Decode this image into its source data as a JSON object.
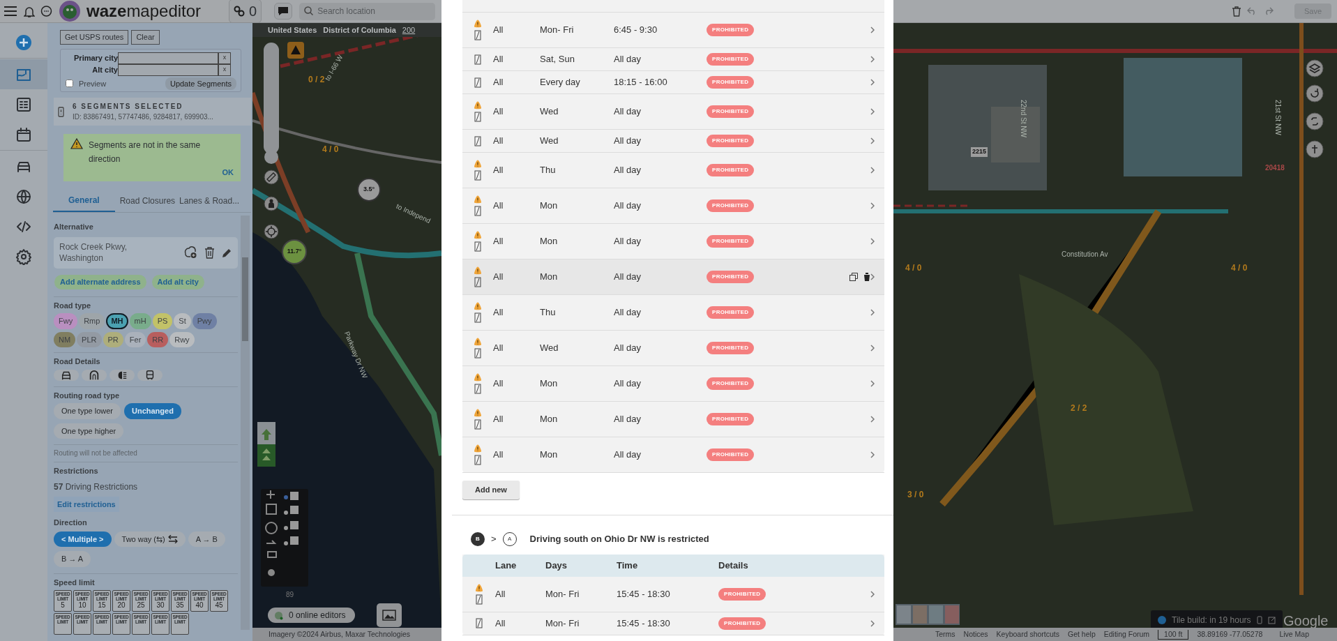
{
  "topbar": {
    "logo_bold": "waze",
    "logo_light": "mapeditor",
    "editors": "0",
    "search": {
      "placeholder": "Search location"
    },
    "save": {
      "label": "Save",
      "disabled": true
    }
  },
  "nav": [
    {
      "kind": "add",
      "selected": false
    },
    {
      "kind": "map",
      "selected": true
    },
    {
      "kind": "list",
      "selected": false
    },
    {
      "kind": "calendar",
      "selected": false
    },
    {
      "kind": "car",
      "selected": false
    },
    {
      "kind": "globe",
      "selected": false
    },
    {
      "kind": "code",
      "selected": false
    },
    {
      "kind": "gear",
      "selected": false
    }
  ],
  "panel": {
    "usps_buttons": [
      "Get USPS routes",
      "Clear"
    ],
    "city_fields": [
      {
        "label": "Primary city",
        "clear": "x"
      },
      {
        "label": "Alt city",
        "clear": "x"
      }
    ],
    "preview": {
      "label": "Preview",
      "checked": false
    },
    "update_button": "Update Segments",
    "selection": {
      "title": "6 SEGMENTS SELECTED",
      "ids": "ID: 83867491, 57747486, 9284817, 699903..."
    },
    "alert": {
      "text": "Segments are not in the same direction",
      "action": "OK"
    },
    "tabs": [
      {
        "label": "General",
        "selected": true
      },
      {
        "label": "Road Closures",
        "selected": false
      },
      {
        "label": "Lanes & Road...",
        "selected": false
      }
    ],
    "alternative": {
      "heading": "Alternative",
      "address": "Rock Creek Pkwy, Washington",
      "actions": [
        "Add alternate address",
        "Add alt city"
      ]
    },
    "road_type": {
      "heading": "Road type",
      "types": [
        {
          "label": "Fwy",
          "color": "#b98fc0",
          "selected": false
        },
        {
          "label": "Rmp",
          "color": "#9ea5a9",
          "selected": false
        },
        {
          "label": "MH",
          "color": "#4ba1b1",
          "selected": true
        },
        {
          "label": "mH",
          "color": "#79ac8b",
          "selected": false
        },
        {
          "label": "PS",
          "color": "#c2c268",
          "selected": false
        },
        {
          "label": "St",
          "color": "#b9bcbf",
          "selected": false
        },
        {
          "label": "Pwy",
          "color": "#6f80a4",
          "selected": false
        },
        {
          "label": "NM",
          "color": "#807e60",
          "selected": false
        },
        {
          "label": "PLR",
          "color": "#939aa3",
          "selected": false
        },
        {
          "label": "PR",
          "color": "#aeae7b",
          "selected": false
        },
        {
          "label": "Fer",
          "color": "#aab1bb",
          "selected": false
        },
        {
          "label": "RR",
          "color": "#b85e5e",
          "selected": false
        },
        {
          "label": "Rwy",
          "color": "#b9bcbf",
          "selected": false
        }
      ]
    },
    "road_details": {
      "heading": "Road Details",
      "items": [
        {
          "kind": "car"
        },
        {
          "kind": "tunnel"
        },
        {
          "kind": "headlight"
        },
        {
          "kind": "bus"
        }
      ]
    },
    "routing": {
      "heading": "Routing road type",
      "options": [
        {
          "label": "One type lower",
          "selected": false
        },
        {
          "label": "Unchanged",
          "selected": true
        },
        {
          "label": "One type higher",
          "selected": false
        }
      ],
      "note": "Routing will not be affected"
    },
    "restrictions": {
      "heading": "Restrictions",
      "count": "57",
      "label": "Driving Restrictions",
      "edit": "Edit restrictions"
    },
    "direction": {
      "heading": "Direction",
      "options": [
        {
          "label": "< Multiple >",
          "selected": true,
          "kind": "text"
        },
        {
          "label": "Two way (⇆)",
          "selected": false,
          "kind": "twoway"
        },
        {
          "label": "A → B",
          "selected": false,
          "kind": "text"
        },
        {
          "label": "B → A",
          "selected": false,
          "kind": "text"
        }
      ]
    },
    "speed_limit": {
      "heading": "Speed limit",
      "signs": [
        {
          "caption": "SPEED LIMIT",
          "value": "5"
        },
        {
          "caption": "SPEED LIMIT",
          "value": "10"
        },
        {
          "caption": "SPEED LIMIT",
          "value": "15"
        },
        {
          "caption": "SPEED LIMIT",
          "value": "20"
        },
        {
          "caption": "SPEED LIMIT",
          "value": "25"
        },
        {
          "caption": "SPEED LIMIT",
          "value": "30"
        },
        {
          "caption": "SPEED LIMIT",
          "value": "35"
        },
        {
          "caption": "SPEED LIMIT",
          "value": "40"
        },
        {
          "caption": "SPEED LIMIT",
          "value": "45"
        },
        {
          "caption": "SPEED LIMIT"
        },
        {
          "caption": "SPEED LIMIT"
        },
        {
          "caption": "SPEED LIMIT"
        },
        {
          "caption": "SPEED LIMIT"
        },
        {
          "caption": "SPEED LIMIT"
        },
        {
          "caption": "SPEED LIMIT"
        },
        {
          "caption": "SPEED LIMIT"
        }
      ]
    }
  },
  "map": {
    "labels": [
      {
        "text": "United States",
        "kind": "top"
      },
      {
        "text": "District of Columbia",
        "kind": "top"
      },
      {
        "text": "200",
        "kind": "toplink"
      },
      {
        "text": "to I-66 W",
        "kind": "road"
      },
      {
        "text": "0 / 2",
        "kind": "count"
      },
      {
        "text": "4 / 0",
        "kind": "count"
      },
      {
        "text": "to Independ",
        "kind": "road"
      },
      {
        "text": "Parkway Dr NW",
        "kind": "road"
      },
      {
        "text": "2215",
        "kind": "house"
      },
      {
        "text": "20418",
        "kind": "number"
      },
      {
        "text": "22nd St NW",
        "kind": "road"
      },
      {
        "text": "21st St NW",
        "kind": "road"
      },
      {
        "text": "Constitution Av",
        "kind": "road"
      },
      {
        "text": "4 / 0",
        "kind": "count"
      },
      {
        "text": "4 / 0",
        "kind": "count"
      },
      {
        "text": "2 / 2",
        "kind": "count"
      },
      {
        "text": "3 / 0",
        "kind": "count"
      },
      {
        "text": "3.5°",
        "kind": "bubble"
      },
      {
        "text": "11.7°",
        "kind": "greenbubble"
      }
    ],
    "zoom_level": "89",
    "online_editors": "0 online editors",
    "tile_build": "Tile build: in 19 hours",
    "attribution": "Google"
  },
  "footer": {
    "imagery": "Imagery ©2024 Airbus, Maxar Technologies",
    "links": [
      "Terms",
      "Notices",
      "Keyboard shortcuts",
      "Get help",
      "Editing Forum"
    ],
    "scale": "100 ft",
    "coords": "38.89169 -77.05278",
    "live_map": "Live Map"
  },
  "dialog": {
    "sections": [
      {
        "rows": [
          {
            "warning": true,
            "lane": "All",
            "days": "Mon- Fri",
            "time": "6:45 - 9:30",
            "details": "PROHIBITED",
            "hovered": false
          },
          {
            "warning": false,
            "lane": "All",
            "days": "Sat, Sun",
            "time": "All day",
            "details": "PROHIBITED",
            "hovered": false
          },
          {
            "warning": false,
            "lane": "All",
            "days": "Every day",
            "time": "18:15 - 16:00",
            "details": "PROHIBITED",
            "hovered": false
          },
          {
            "warning": true,
            "lane": "All",
            "days": "Wed",
            "time": "All day",
            "details": "PROHIBITED",
            "hovered": false
          },
          {
            "warning": false,
            "lane": "All",
            "days": "Wed",
            "time": "All day",
            "details": "PROHIBITED",
            "hovered": false
          },
          {
            "warning": true,
            "lane": "All",
            "days": "Thu",
            "time": "All day",
            "details": "PROHIBITED",
            "hovered": false
          },
          {
            "warning": true,
            "lane": "All",
            "days": "Mon",
            "time": "All day",
            "details": "PROHIBITED",
            "hovered": false
          },
          {
            "warning": true,
            "lane": "All",
            "days": "Mon",
            "time": "All day",
            "details": "PROHIBITED",
            "hovered": false
          },
          {
            "warning": true,
            "lane": "All",
            "days": "Mon",
            "time": "All day",
            "details": "PROHIBITED",
            "hovered": true
          },
          {
            "warning": true,
            "lane": "All",
            "days": "Thu",
            "time": "All day",
            "details": "PROHIBITED",
            "hovered": false
          },
          {
            "warning": true,
            "lane": "All",
            "days": "Wed",
            "time": "All day",
            "details": "PROHIBITED",
            "hovered": false
          },
          {
            "warning": true,
            "lane": "All",
            "days": "Mon",
            "time": "All day",
            "details": "PROHIBITED",
            "hovered": false
          },
          {
            "warning": true,
            "lane": "All",
            "days": "Mon",
            "time": "All day",
            "details": "PROHIBITED",
            "hovered": false
          },
          {
            "warning": true,
            "lane": "All",
            "days": "Mon",
            "time": "All day",
            "details": "PROHIBITED",
            "hovered": false
          }
        ],
        "add_button": "Add new"
      },
      {
        "from": "B",
        "separator": ">",
        "to": "A",
        "title": "Driving south on Ohio Dr NW is restricted",
        "columns": [
          "Lane",
          "Days",
          "Time",
          "Details"
        ],
        "rows": [
          {
            "warning": true,
            "lane": "All",
            "days": "Mon- Fri",
            "time": "15:45 - 18:30",
            "details": "PROHIBITED",
            "hovered": false
          },
          {
            "warning": false,
            "lane": "All",
            "days": "Mon- Fri",
            "time": "15:45 - 18:30",
            "details": "PROHIBITED",
            "hovered": false
          }
        ]
      }
    ]
  }
}
